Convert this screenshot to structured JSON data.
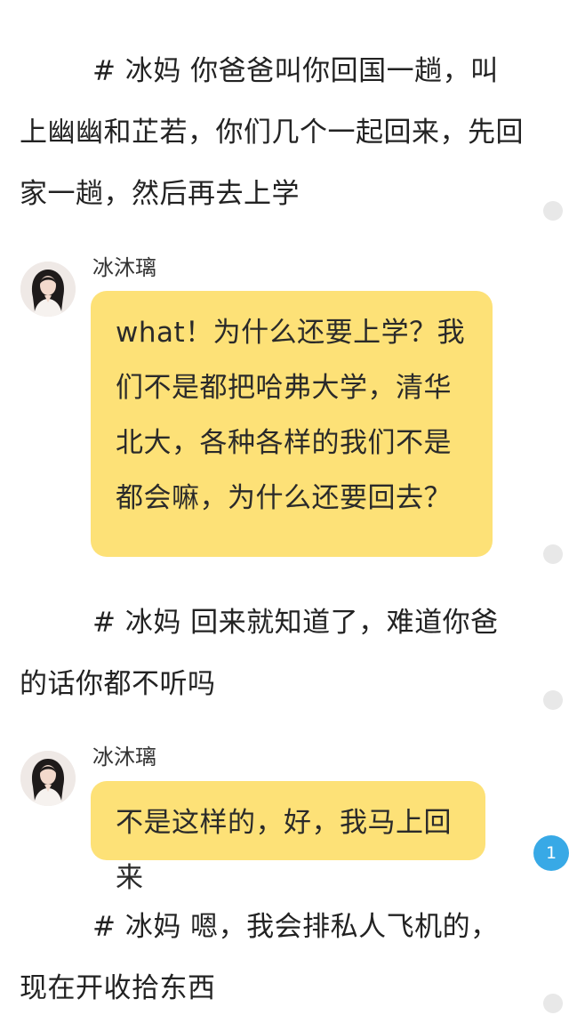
{
  "story": [
    {
      "type": "narration",
      "text": "# 冰妈 你爸爸叫你回国一趟，叫上幽幽和芷若，你们几个一起回来，先回家一趟，然后再去上学"
    },
    {
      "type": "message",
      "sender": "冰沐璃",
      "avatar_icon": "woman-portrait-avatar",
      "text": "what！为什么还要上学？我们不是都把哈弗大学，清华北大，各种各样的我们不是都会嘛，为什么还要回去？"
    },
    {
      "type": "narration",
      "text": "# 冰妈 回来就知道了，难道你爸的话你都不听吗"
    },
    {
      "type": "message",
      "sender": "冰沐璃",
      "avatar_icon": "woman-portrait-avatar",
      "text": "不是这样的，好，我马上回来",
      "comment_count": "1"
    },
    {
      "type": "narration",
      "text": "# 冰妈 嗯，我会排私人飞机的，现在开收拾东西"
    }
  ],
  "colors": {
    "bubble": "#fde177",
    "badge": "#38a9e6",
    "dot": "#e8e8e8"
  }
}
